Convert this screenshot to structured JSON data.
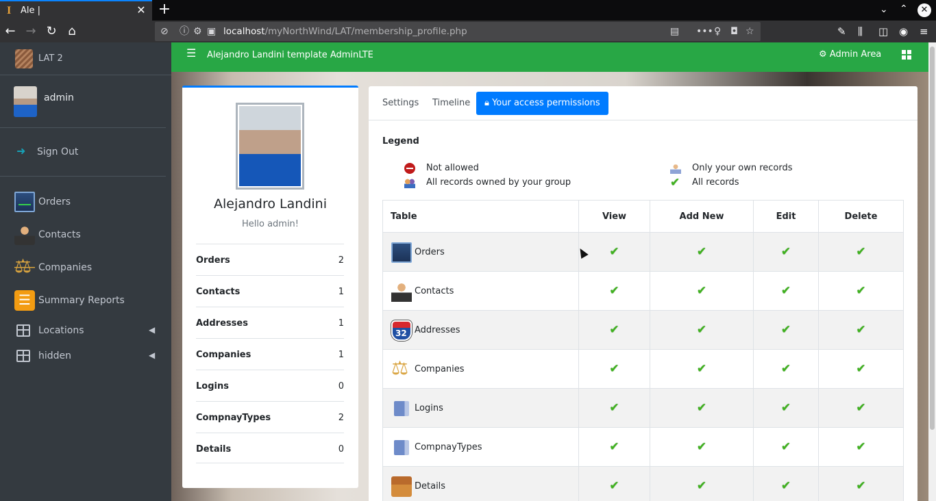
{
  "browser": {
    "tab_title": "Ale |",
    "tab_favicon": "I",
    "close_glyph": "✕",
    "new_tab_glyph": "+",
    "url_host": "localhost",
    "url_path": "/myNorthWind/LAT/membership_profile.php",
    "icons": [
      "back-icon",
      "forward-icon",
      "reload-icon",
      "home-icon",
      "reader-icon",
      "more-icon",
      "lightbulb-icon",
      "pocket-icon",
      "star-icon",
      "wrench-icon",
      "library-icon",
      "sidebar-icon",
      "account-icon",
      "menu-icon"
    ]
  },
  "sidebar": {
    "brand": "LAT 2",
    "user": "admin",
    "signout": "Sign Out",
    "items": [
      {
        "label": "Orders",
        "icon": "orders-icon"
      },
      {
        "label": "Contacts",
        "icon": "contacts-icon"
      },
      {
        "label": "Companies",
        "icon": "companies-icon"
      },
      {
        "label": "Summary Reports",
        "icon": "summary-reports-icon"
      },
      {
        "label": "Locations",
        "icon": "table-icon"
      },
      {
        "label": "hidden",
        "icon": "table-icon"
      }
    ]
  },
  "header": {
    "title": "Alejandro Landini template AdminLTE",
    "admin_area": "Admin Area",
    "colors": {
      "header_bg": "#28a745",
      "accent": "#007bff"
    }
  },
  "profile": {
    "name": "Alejandro Landini",
    "greeting": "Hello admin!",
    "stats": [
      {
        "label": "Orders",
        "value": "2"
      },
      {
        "label": "Contacts",
        "value": "1"
      },
      {
        "label": "Addresses",
        "value": "1"
      },
      {
        "label": "Companies",
        "value": "1"
      },
      {
        "label": "Logins",
        "value": "0"
      },
      {
        "label": "CompnayTypes",
        "value": "2"
      },
      {
        "label": "Details",
        "value": "0"
      }
    ]
  },
  "permissions": {
    "tabs": [
      "Settings",
      "Timeline",
      "Your access permissions"
    ],
    "active_tab": "Your access permissions",
    "legend_title": "Legend",
    "legend": {
      "not_allowed": "Not allowed",
      "group": "All records owned by your group",
      "own": "Only your own records",
      "all": "All records"
    },
    "headers": [
      "Table",
      "View",
      "Add New",
      "Edit",
      "Delete"
    ],
    "rows": [
      {
        "table": "Orders",
        "view": "all",
        "add_new": "all",
        "edit": "all",
        "delete": "all"
      },
      {
        "table": "Contacts",
        "view": "all",
        "add_new": "all",
        "edit": "all",
        "delete": "all"
      },
      {
        "table": "Addresses",
        "view": "all",
        "add_new": "all",
        "edit": "all",
        "delete": "all"
      },
      {
        "table": "Companies",
        "view": "all",
        "add_new": "all",
        "edit": "all",
        "delete": "all"
      },
      {
        "table": "Logins",
        "view": "all",
        "add_new": "all",
        "edit": "all",
        "delete": "all"
      },
      {
        "table": "CompnayTypes",
        "view": "all",
        "add_new": "all",
        "edit": "all",
        "delete": "all"
      },
      {
        "table": "Details",
        "view": "all",
        "add_new": "all",
        "edit": "all",
        "delete": "all"
      }
    ]
  }
}
